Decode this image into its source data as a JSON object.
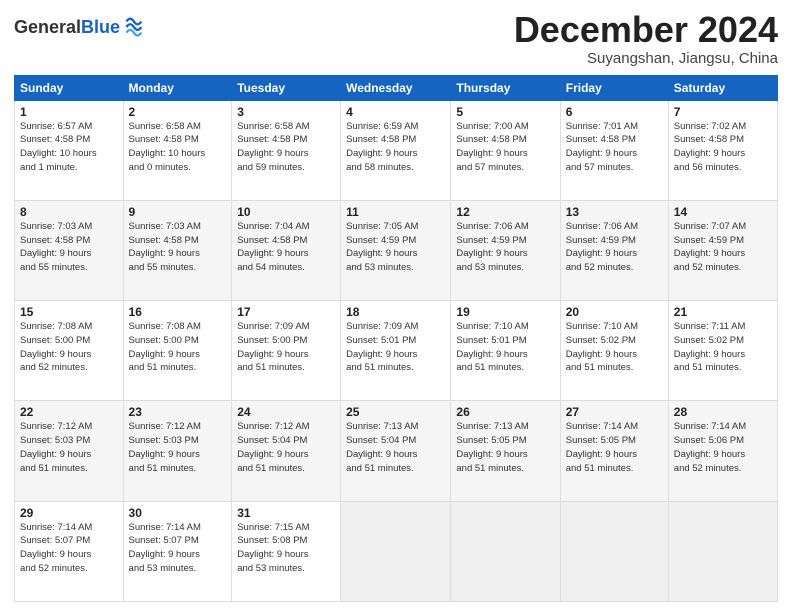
{
  "logo": {
    "general": "General",
    "blue": "Blue"
  },
  "header": {
    "month": "December 2024",
    "location": "Suyangshan, Jiangsu, China"
  },
  "weekdays": [
    "Sunday",
    "Monday",
    "Tuesday",
    "Wednesday",
    "Thursday",
    "Friday",
    "Saturday"
  ],
  "weeks": [
    [
      {
        "day": "1",
        "info": "Sunrise: 6:57 AM\nSunset: 4:58 PM\nDaylight: 10 hours\nand 1 minute."
      },
      {
        "day": "2",
        "info": "Sunrise: 6:58 AM\nSunset: 4:58 PM\nDaylight: 10 hours\nand 0 minutes."
      },
      {
        "day": "3",
        "info": "Sunrise: 6:58 AM\nSunset: 4:58 PM\nDaylight: 9 hours\nand 59 minutes."
      },
      {
        "day": "4",
        "info": "Sunrise: 6:59 AM\nSunset: 4:58 PM\nDaylight: 9 hours\nand 58 minutes."
      },
      {
        "day": "5",
        "info": "Sunrise: 7:00 AM\nSunset: 4:58 PM\nDaylight: 9 hours\nand 57 minutes."
      },
      {
        "day": "6",
        "info": "Sunrise: 7:01 AM\nSunset: 4:58 PM\nDaylight: 9 hours\nand 57 minutes."
      },
      {
        "day": "7",
        "info": "Sunrise: 7:02 AM\nSunset: 4:58 PM\nDaylight: 9 hours\nand 56 minutes."
      }
    ],
    [
      {
        "day": "8",
        "info": "Sunrise: 7:03 AM\nSunset: 4:58 PM\nDaylight: 9 hours\nand 55 minutes."
      },
      {
        "day": "9",
        "info": "Sunrise: 7:03 AM\nSunset: 4:58 PM\nDaylight: 9 hours\nand 55 minutes."
      },
      {
        "day": "10",
        "info": "Sunrise: 7:04 AM\nSunset: 4:58 PM\nDaylight: 9 hours\nand 54 minutes."
      },
      {
        "day": "11",
        "info": "Sunrise: 7:05 AM\nSunset: 4:59 PM\nDaylight: 9 hours\nand 53 minutes."
      },
      {
        "day": "12",
        "info": "Sunrise: 7:06 AM\nSunset: 4:59 PM\nDaylight: 9 hours\nand 53 minutes."
      },
      {
        "day": "13",
        "info": "Sunrise: 7:06 AM\nSunset: 4:59 PM\nDaylight: 9 hours\nand 52 minutes."
      },
      {
        "day": "14",
        "info": "Sunrise: 7:07 AM\nSunset: 4:59 PM\nDaylight: 9 hours\nand 52 minutes."
      }
    ],
    [
      {
        "day": "15",
        "info": "Sunrise: 7:08 AM\nSunset: 5:00 PM\nDaylight: 9 hours\nand 52 minutes."
      },
      {
        "day": "16",
        "info": "Sunrise: 7:08 AM\nSunset: 5:00 PM\nDaylight: 9 hours\nand 51 minutes."
      },
      {
        "day": "17",
        "info": "Sunrise: 7:09 AM\nSunset: 5:00 PM\nDaylight: 9 hours\nand 51 minutes."
      },
      {
        "day": "18",
        "info": "Sunrise: 7:09 AM\nSunset: 5:01 PM\nDaylight: 9 hours\nand 51 minutes."
      },
      {
        "day": "19",
        "info": "Sunrise: 7:10 AM\nSunset: 5:01 PM\nDaylight: 9 hours\nand 51 minutes."
      },
      {
        "day": "20",
        "info": "Sunrise: 7:10 AM\nSunset: 5:02 PM\nDaylight: 9 hours\nand 51 minutes."
      },
      {
        "day": "21",
        "info": "Sunrise: 7:11 AM\nSunset: 5:02 PM\nDaylight: 9 hours\nand 51 minutes."
      }
    ],
    [
      {
        "day": "22",
        "info": "Sunrise: 7:12 AM\nSunset: 5:03 PM\nDaylight: 9 hours\nand 51 minutes."
      },
      {
        "day": "23",
        "info": "Sunrise: 7:12 AM\nSunset: 5:03 PM\nDaylight: 9 hours\nand 51 minutes."
      },
      {
        "day": "24",
        "info": "Sunrise: 7:12 AM\nSunset: 5:04 PM\nDaylight: 9 hours\nand 51 minutes."
      },
      {
        "day": "25",
        "info": "Sunrise: 7:13 AM\nSunset: 5:04 PM\nDaylight: 9 hours\nand 51 minutes."
      },
      {
        "day": "26",
        "info": "Sunrise: 7:13 AM\nSunset: 5:05 PM\nDaylight: 9 hours\nand 51 minutes."
      },
      {
        "day": "27",
        "info": "Sunrise: 7:14 AM\nSunset: 5:05 PM\nDaylight: 9 hours\nand 51 minutes."
      },
      {
        "day": "28",
        "info": "Sunrise: 7:14 AM\nSunset: 5:06 PM\nDaylight: 9 hours\nand 52 minutes."
      }
    ],
    [
      {
        "day": "29",
        "info": "Sunrise: 7:14 AM\nSunset: 5:07 PM\nDaylight: 9 hours\nand 52 minutes."
      },
      {
        "day": "30",
        "info": "Sunrise: 7:14 AM\nSunset: 5:07 PM\nDaylight: 9 hours\nand 53 minutes."
      },
      {
        "day": "31",
        "info": "Sunrise: 7:15 AM\nSunset: 5:08 PM\nDaylight: 9 hours\nand 53 minutes."
      },
      null,
      null,
      null,
      null
    ]
  ]
}
